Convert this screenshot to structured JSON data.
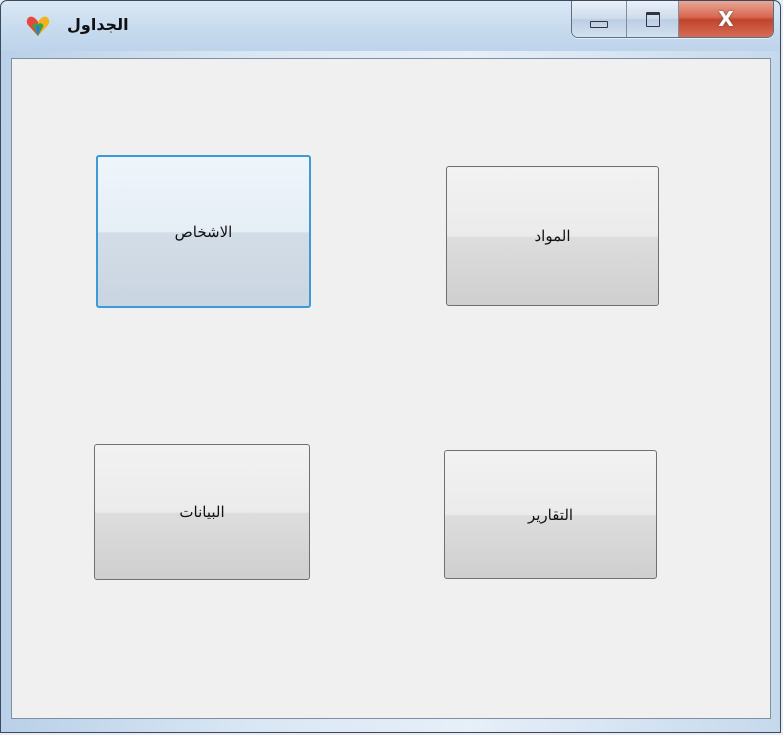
{
  "window": {
    "title": "الجداول",
    "caption_buttons": {
      "minimize": "minimize",
      "maximize": "maximize",
      "close": "X"
    }
  },
  "buttons": {
    "people": "الاشخاص",
    "materials": "المواد",
    "data": "البيانات",
    "reports": "التقارير"
  },
  "colors": {
    "focus_border": "#3c9ad6",
    "client_bg": "#f0f0f0",
    "close_red": "#c0432c"
  }
}
